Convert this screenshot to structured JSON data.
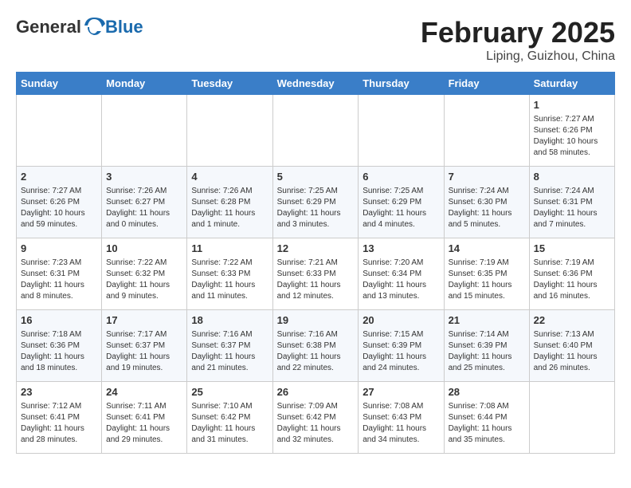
{
  "header": {
    "logo": {
      "general": "General",
      "blue": "Blue"
    },
    "title": "February 2025",
    "subtitle": "Liping, Guizhou, China"
  },
  "weekdays": [
    "Sunday",
    "Monday",
    "Tuesday",
    "Wednesday",
    "Thursday",
    "Friday",
    "Saturday"
  ],
  "weeks": [
    [
      {
        "day": "",
        "info": ""
      },
      {
        "day": "",
        "info": ""
      },
      {
        "day": "",
        "info": ""
      },
      {
        "day": "",
        "info": ""
      },
      {
        "day": "",
        "info": ""
      },
      {
        "day": "",
        "info": ""
      },
      {
        "day": "1",
        "info": "Sunrise: 7:27 AM\nSunset: 6:26 PM\nDaylight: 10 hours\nand 58 minutes."
      }
    ],
    [
      {
        "day": "2",
        "info": "Sunrise: 7:27 AM\nSunset: 6:26 PM\nDaylight: 10 hours\nand 59 minutes."
      },
      {
        "day": "3",
        "info": "Sunrise: 7:26 AM\nSunset: 6:27 PM\nDaylight: 11 hours\nand 0 minutes."
      },
      {
        "day": "4",
        "info": "Sunrise: 7:26 AM\nSunset: 6:28 PM\nDaylight: 11 hours\nand 1 minute."
      },
      {
        "day": "5",
        "info": "Sunrise: 7:25 AM\nSunset: 6:29 PM\nDaylight: 11 hours\nand 3 minutes."
      },
      {
        "day": "6",
        "info": "Sunrise: 7:25 AM\nSunset: 6:29 PM\nDaylight: 11 hours\nand 4 minutes."
      },
      {
        "day": "7",
        "info": "Sunrise: 7:24 AM\nSunset: 6:30 PM\nDaylight: 11 hours\nand 5 minutes."
      },
      {
        "day": "8",
        "info": "Sunrise: 7:24 AM\nSunset: 6:31 PM\nDaylight: 11 hours\nand 7 minutes."
      }
    ],
    [
      {
        "day": "9",
        "info": "Sunrise: 7:23 AM\nSunset: 6:31 PM\nDaylight: 11 hours\nand 8 minutes."
      },
      {
        "day": "10",
        "info": "Sunrise: 7:22 AM\nSunset: 6:32 PM\nDaylight: 11 hours\nand 9 minutes."
      },
      {
        "day": "11",
        "info": "Sunrise: 7:22 AM\nSunset: 6:33 PM\nDaylight: 11 hours\nand 11 minutes."
      },
      {
        "day": "12",
        "info": "Sunrise: 7:21 AM\nSunset: 6:33 PM\nDaylight: 11 hours\nand 12 minutes."
      },
      {
        "day": "13",
        "info": "Sunrise: 7:20 AM\nSunset: 6:34 PM\nDaylight: 11 hours\nand 13 minutes."
      },
      {
        "day": "14",
        "info": "Sunrise: 7:19 AM\nSunset: 6:35 PM\nDaylight: 11 hours\nand 15 minutes."
      },
      {
        "day": "15",
        "info": "Sunrise: 7:19 AM\nSunset: 6:36 PM\nDaylight: 11 hours\nand 16 minutes."
      }
    ],
    [
      {
        "day": "16",
        "info": "Sunrise: 7:18 AM\nSunset: 6:36 PM\nDaylight: 11 hours\nand 18 minutes."
      },
      {
        "day": "17",
        "info": "Sunrise: 7:17 AM\nSunset: 6:37 PM\nDaylight: 11 hours\nand 19 minutes."
      },
      {
        "day": "18",
        "info": "Sunrise: 7:16 AM\nSunset: 6:37 PM\nDaylight: 11 hours\nand 21 minutes."
      },
      {
        "day": "19",
        "info": "Sunrise: 7:16 AM\nSunset: 6:38 PM\nDaylight: 11 hours\nand 22 minutes."
      },
      {
        "day": "20",
        "info": "Sunrise: 7:15 AM\nSunset: 6:39 PM\nDaylight: 11 hours\nand 24 minutes."
      },
      {
        "day": "21",
        "info": "Sunrise: 7:14 AM\nSunset: 6:39 PM\nDaylight: 11 hours\nand 25 minutes."
      },
      {
        "day": "22",
        "info": "Sunrise: 7:13 AM\nSunset: 6:40 PM\nDaylight: 11 hours\nand 26 minutes."
      }
    ],
    [
      {
        "day": "23",
        "info": "Sunrise: 7:12 AM\nSunset: 6:41 PM\nDaylight: 11 hours\nand 28 minutes."
      },
      {
        "day": "24",
        "info": "Sunrise: 7:11 AM\nSunset: 6:41 PM\nDaylight: 11 hours\nand 29 minutes."
      },
      {
        "day": "25",
        "info": "Sunrise: 7:10 AM\nSunset: 6:42 PM\nDaylight: 11 hours\nand 31 minutes."
      },
      {
        "day": "26",
        "info": "Sunrise: 7:09 AM\nSunset: 6:42 PM\nDaylight: 11 hours\nand 32 minutes."
      },
      {
        "day": "27",
        "info": "Sunrise: 7:08 AM\nSunset: 6:43 PM\nDaylight: 11 hours\nand 34 minutes."
      },
      {
        "day": "28",
        "info": "Sunrise: 7:08 AM\nSunset: 6:44 PM\nDaylight: 11 hours\nand 35 minutes."
      },
      {
        "day": "",
        "info": ""
      }
    ]
  ]
}
